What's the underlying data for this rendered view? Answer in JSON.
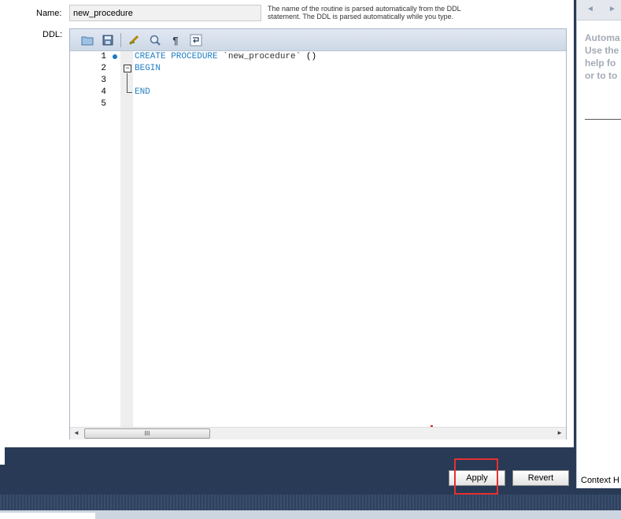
{
  "form": {
    "name_label": "Name:",
    "name_value": "new_procedure",
    "name_hint": "The name of the routine is parsed automatically from the DDL statement. The DDL is parsed automatically while you type.",
    "ddl_label": "DDL:"
  },
  "toolbar": {
    "icons": [
      "open-folder-icon",
      "save-icon",
      "beautify-icon",
      "find-icon",
      "show-whitespace-icon",
      "word-wrap-icon"
    ]
  },
  "editor": {
    "line_numbers": [
      "1",
      "2",
      "3",
      "4",
      "5"
    ],
    "lines": [
      {
        "kw": "CREATE PROCEDURE",
        "name": "`new_procedure`",
        "rest": "()"
      },
      {
        "kw": "BEGIN"
      },
      {
        "kw": ""
      },
      {
        "kw": "END"
      },
      {
        "kw": ""
      }
    ],
    "scroll_thumb_grip": "III"
  },
  "context_help": {
    "nav_back": "◄",
    "nav_forward": "►",
    "text_lines": [
      "Automa",
      "Use the",
      "help fo",
      "or to to"
    ],
    "tab_label": "Context H"
  },
  "actions": {
    "apply_label": "Apply",
    "revert_label": "Revert"
  },
  "colors": {
    "keyword": "#1f7fc3",
    "highlight": "#e53030",
    "chrome": "#283a55"
  }
}
